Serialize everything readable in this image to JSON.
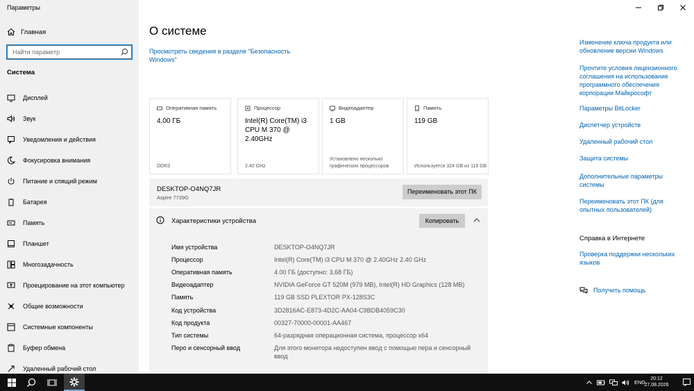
{
  "app": {
    "title": "Параметры"
  },
  "sidebar": {
    "home_label": "Главная",
    "search_placeholder": "Найти параметр",
    "section": "Система",
    "items": [
      {
        "label": "Дисплей",
        "icon": "display-icon"
      },
      {
        "label": "Звук",
        "icon": "speaker-icon"
      },
      {
        "label": "Уведомления и действия",
        "icon": "notification-icon"
      },
      {
        "label": "Фокусировка внимания",
        "icon": "moon-icon"
      },
      {
        "label": "Питание и спящий режим",
        "icon": "power-icon"
      },
      {
        "label": "Батарея",
        "icon": "battery-icon"
      },
      {
        "label": "Память",
        "icon": "storage-icon"
      },
      {
        "label": "Планшет",
        "icon": "tablet-icon"
      },
      {
        "label": "Многозадачность",
        "icon": "multitasking-icon"
      },
      {
        "label": "Проецирование на этот компьютер",
        "icon": "projecting-icon"
      },
      {
        "label": "Общие возможности",
        "icon": "shared-experiences-icon"
      },
      {
        "label": "Системные компоненты",
        "icon": "components-icon"
      },
      {
        "label": "Буфер обмена",
        "icon": "clipboard-icon"
      },
      {
        "label": "Удаленный рабочий стол",
        "icon": "remote-desktop-icon"
      }
    ]
  },
  "main": {
    "title": "О системе",
    "security_link": "Просмотреть сведения в разделе \"Безопасность Windows\"",
    "cards": [
      {
        "header": "Оперативная память",
        "value": "4,00 ГБ",
        "footer": "DDR3",
        "icon": "ram-icon"
      },
      {
        "header": "Процессор",
        "value": "Intel(R) Core(TM) i3 CPU       M 370  @ 2.40GHz",
        "footer": "2.40 GHz",
        "icon": "processor-icon"
      },
      {
        "header": "Видеоадаптер",
        "value": "1 GB",
        "footer": "Установлено несколько графических процессоров",
        "icon": "graphics-icon"
      },
      {
        "header": "Память",
        "value": "119 GB",
        "footer": "Используется 324 GB из 119 GB",
        "icon": "storage-icon"
      }
    ],
    "device_name": "DESKTOP-O4NQ7JR",
    "device_model": "Aspire 7739G",
    "rename_button": "Переименовать этот ПК",
    "specs_title": "Характеристики устройства",
    "copy_button": "Копировать",
    "specs": [
      {
        "key": "Имя устройства",
        "value": "DESKTOP-O4NQ7JR"
      },
      {
        "key": "Процессор",
        "value": "Intel(R) Core(TM) i3 CPU       M 370  @ 2.40GHz   2.40 GHz"
      },
      {
        "key": "Оперативная память",
        "value": "4.00 ГБ (доступно: 3,68 ГБ)"
      },
      {
        "key": "Видеоадаптер",
        "value": "NVIDIA GeForce GT 520M (979 MB), Intel(R) HD Graphics (128 MB)"
      },
      {
        "key": "Память",
        "value": "119 GB SSD PLEXTOR PX-128S3C"
      },
      {
        "key": "Код устройства",
        "value": "3D2816AC-E873-4D2C-AA04-C9BDB4059C30"
      },
      {
        "key": "Код продукта",
        "value": "00327-70000-00001-AA467"
      },
      {
        "key": "Тип системы",
        "value": "64-разрядная операционная система, процессор x64"
      },
      {
        "key": "Перо и сенсорный ввод",
        "value": "Для этого монитора недоступен ввод с помощью пера и сенсорный ввод"
      }
    ]
  },
  "related": {
    "links": [
      "Изменение ключа продукта или обновление версии Windows",
      "Прочтите условия лицензионного соглашения на использование программного обеспечения корпорации Майкрософт",
      "Параметры BitLocker",
      "Диспетчер устройств",
      "Удаленный рабочий стол",
      "Защита системы",
      "Дополнительные параметры системы",
      "Переименовать этот ПК (для опытных пользователей)"
    ],
    "help_heading": "Справка в Интернете",
    "help_links": [
      "Проверка поддержки нескольких языков"
    ],
    "get_help": "Получить помощь"
  },
  "taskbar": {
    "language": "ENG",
    "time": "20:12",
    "date": "27.08.2026"
  },
  "colors": {
    "accent": "#0063b1",
    "sidebar_bg": "#f0f0f0",
    "taskbar_bg": "#101010"
  }
}
